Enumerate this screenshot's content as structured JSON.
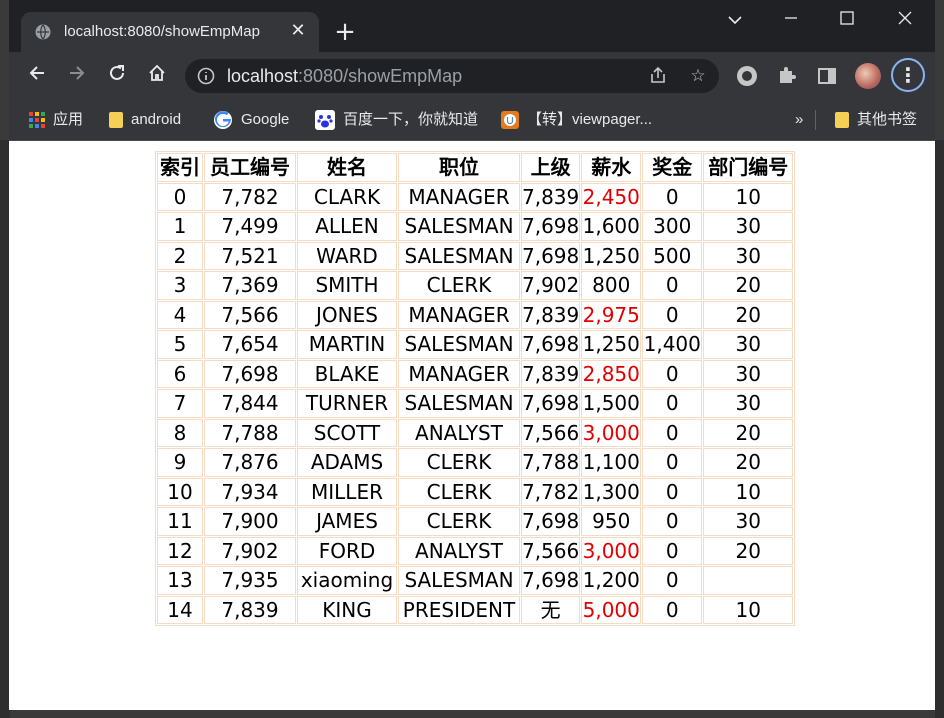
{
  "browser": {
    "tab_title": "localhost:8080/showEmpMap",
    "url_host": "localhost",
    "url_rest": ":8080/showEmpMap",
    "new_tab_label": "+",
    "window_controls": [
      "chevron-down",
      "minimize",
      "maximize",
      "close"
    ]
  },
  "bookmarks": [
    {
      "label": "应用",
      "icon": "apps-grid-icon"
    },
    {
      "label": "android",
      "icon": "folder-icon"
    },
    {
      "label": "Google",
      "icon": "google-icon"
    },
    {
      "label": "百度一下，你就知道",
      "icon": "baidu-icon"
    },
    {
      "label": "【转】viewpager...",
      "icon": "site-icon"
    }
  ],
  "bookmarks_overflow": "»",
  "other_bookmarks": "其他书签",
  "table": {
    "headers": [
      "索引",
      "员工编号",
      "姓名",
      "职位",
      "上级",
      "薪水",
      "奖金",
      "部门编号"
    ],
    "rows": [
      [
        "0",
        "7,782",
        "CLARK",
        "MANAGER",
        "7,839",
        "2,450",
        "0",
        "10"
      ],
      [
        "1",
        "7,499",
        "ALLEN",
        "SALESMAN",
        "7,698",
        "1,600",
        "300",
        "30"
      ],
      [
        "2",
        "7,521",
        "WARD",
        "SALESMAN",
        "7,698",
        "1,250",
        "500",
        "30"
      ],
      [
        "3",
        "7,369",
        "SMITH",
        "CLERK",
        "7,902",
        "800",
        "0",
        "20"
      ],
      [
        "4",
        "7,566",
        "JONES",
        "MANAGER",
        "7,839",
        "2,975",
        "0",
        "20"
      ],
      [
        "5",
        "7,654",
        "MARTIN",
        "SALESMAN",
        "7,698",
        "1,250",
        "1,400",
        "30"
      ],
      [
        "6",
        "7,698",
        "BLAKE",
        "MANAGER",
        "7,839",
        "2,850",
        "0",
        "30"
      ],
      [
        "7",
        "7,844",
        "TURNER",
        "SALESMAN",
        "7,698",
        "1,500",
        "0",
        "30"
      ],
      [
        "8",
        "7,788",
        "SCOTT",
        "ANALYST",
        "7,566",
        "3,000",
        "0",
        "20"
      ],
      [
        "9",
        "7,876",
        "ADAMS",
        "CLERK",
        "7,788",
        "1,100",
        "0",
        "20"
      ],
      [
        "10",
        "7,934",
        "MILLER",
        "CLERK",
        "7,782",
        "1,300",
        "0",
        "10"
      ],
      [
        "11",
        "7,900",
        "JAMES",
        "CLERK",
        "7,698",
        "950",
        "0",
        "30"
      ],
      [
        "12",
        "7,902",
        "FORD",
        "ANALYST",
        "7,566",
        "3,000",
        "0",
        "20"
      ],
      [
        "13",
        "7,935",
        "xiaoming",
        "SALESMAN",
        "7,698",
        "1,200",
        "0",
        ""
      ],
      [
        "14",
        "7,839",
        "KING",
        "PRESIDENT",
        "无",
        "5,000",
        "0",
        "10"
      ]
    ],
    "highlight_rows": [
      0,
      4,
      6,
      8,
      12,
      14
    ],
    "highlight_color": "#e00000",
    "border_color": "#f3dcc3"
  }
}
